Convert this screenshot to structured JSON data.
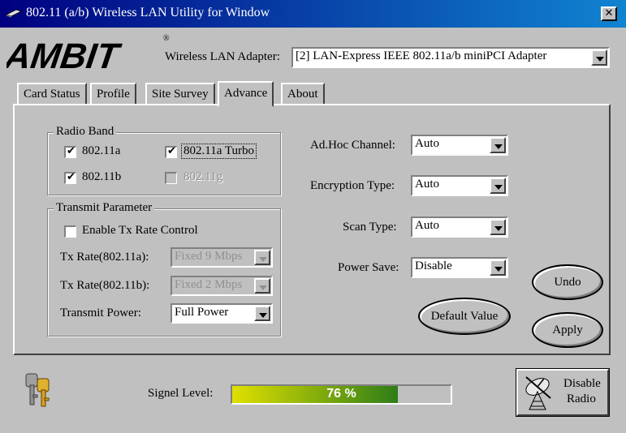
{
  "window": {
    "title": "802.11 (a/b) Wireless LAN Utility for Window",
    "close_glyph": "✕"
  },
  "header": {
    "logo_text": "AMBIT",
    "logo_mark": "®",
    "adapter_label": "Wireless LAN Adapter:",
    "adapter_value": "[2] LAN-Express IEEE 802.11a/b miniPCI Adapter"
  },
  "tabs": [
    {
      "label": "Card Status",
      "active": false
    },
    {
      "label": "Profile",
      "active": false
    },
    {
      "label": "Site Survey",
      "active": false
    },
    {
      "label": "Advance",
      "active": true
    },
    {
      "label": "About",
      "active": false
    }
  ],
  "radio_band": {
    "title": "Radio Band",
    "options": [
      {
        "label": "802.11a",
        "checked": true,
        "enabled": true
      },
      {
        "label": "802.11a Turbo",
        "checked": true,
        "enabled": true
      },
      {
        "label": "802.11b",
        "checked": true,
        "enabled": true
      },
      {
        "label": "802.11g",
        "checked": false,
        "enabled": false
      }
    ]
  },
  "transmit": {
    "title": "Transmit Parameter",
    "enable_label": "Enable Tx Rate Control",
    "enable_checked": false,
    "rate_a_label": "Tx Rate(802.11a):",
    "rate_a_value": "Fixed 9 Mbps",
    "rate_b_label": "Tx Rate(802.11b):",
    "rate_b_value": "Fixed 2 Mbps",
    "power_label": "Transmit Power:",
    "power_value": "Full Power"
  },
  "settings": {
    "adhoc_label": "Ad.Hoc Channel:",
    "adhoc_value": "Auto",
    "encryption_label": "Encryption Type:",
    "encryption_value": "Auto",
    "scan_label": "Scan Type:",
    "scan_value": "Auto",
    "power_save_label": "Power Save:",
    "power_save_value": "Disable"
  },
  "buttons": {
    "default_value": "Default Value",
    "undo": "Undo",
    "apply": "Apply",
    "disable_radio_line1": "Disable",
    "disable_radio_line2": "Radio"
  },
  "signal": {
    "label": "Signel Level:",
    "percent_text": "76 %",
    "level": 0.76
  },
  "colors": {
    "title_bar_start": "#000080",
    "title_bar_end": "#1084d0",
    "signal_fill_start": "#e0e000",
    "signal_fill_end": "#2e7d18",
    "logo": "#000000"
  },
  "icons": {
    "title_icon": "network-card-icon",
    "keys_icon": "keys-icon",
    "radio_icon": "satellite-dish-icon",
    "dropdown": "chevron-down-icon"
  }
}
